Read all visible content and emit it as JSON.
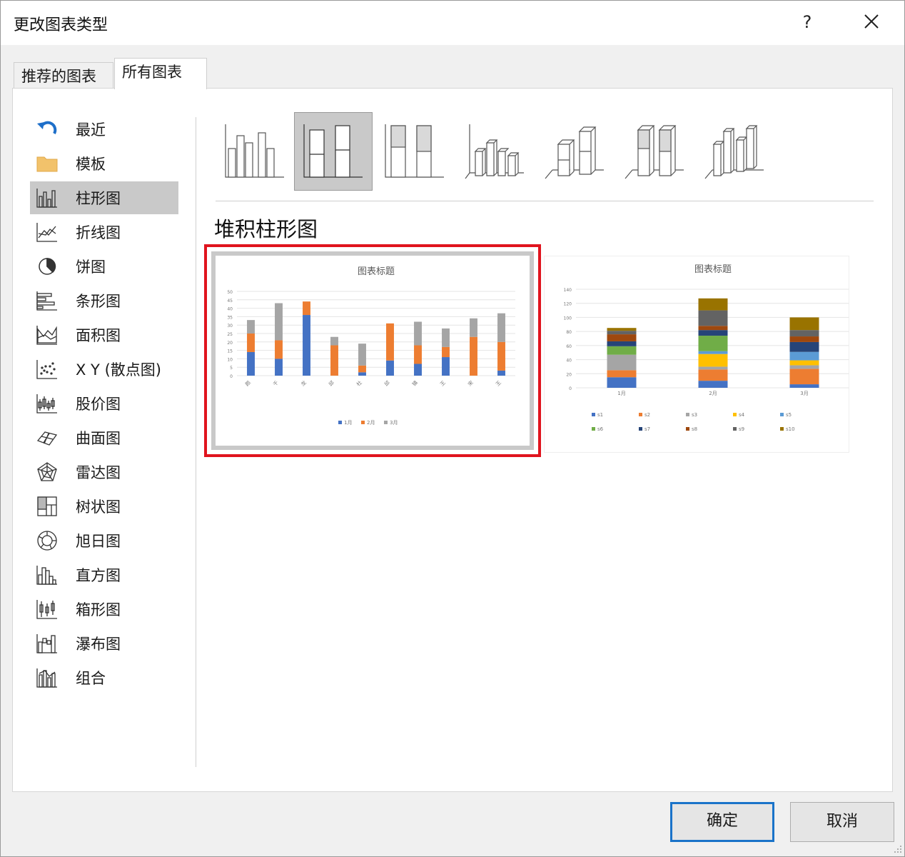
{
  "window": {
    "title": "更改图表类型",
    "help_label": "?"
  },
  "tabs": [
    {
      "label": "推荐的图表"
    },
    {
      "label": "所有图表"
    }
  ],
  "categories": [
    {
      "label": "最近",
      "icon": "recent-icon"
    },
    {
      "label": "模板",
      "icon": "folder-icon"
    },
    {
      "label": "柱形图",
      "icon": "column-chart-icon"
    },
    {
      "label": "折线图",
      "icon": "line-chart-icon"
    },
    {
      "label": "饼图",
      "icon": "pie-chart-icon"
    },
    {
      "label": "条形图",
      "icon": "bar-chart-icon"
    },
    {
      "label": "面积图",
      "icon": "area-chart-icon"
    },
    {
      "label": "X Y (散点图)",
      "icon": "scatter-chart-icon"
    },
    {
      "label": "股价图",
      "icon": "stock-chart-icon"
    },
    {
      "label": "曲面图",
      "icon": "surface-chart-icon"
    },
    {
      "label": "雷达图",
      "icon": "radar-chart-icon"
    },
    {
      "label": "树状图",
      "icon": "treemap-chart-icon"
    },
    {
      "label": "旭日图",
      "icon": "sunburst-chart-icon"
    },
    {
      "label": "直方图",
      "icon": "histogram-chart-icon"
    },
    {
      "label": "箱形图",
      "icon": "box-whisker-chart-icon"
    },
    {
      "label": "瀑布图",
      "icon": "waterfall-chart-icon"
    },
    {
      "label": "组合",
      "icon": "combo-chart-icon"
    }
  ],
  "selected_category": "柱形图",
  "subtypes": [
    "clustered-column-icon",
    "stacked-column-icon",
    "100-stacked-column-icon",
    "3d-clustered-column-icon",
    "3d-stacked-column-icon",
    "3d-100-stacked-column-icon",
    "3d-column-icon"
  ],
  "selected_subtype_name": "堆积柱形图",
  "chart_data": [
    {
      "type": "bar",
      "stacked": true,
      "title": "图表标题",
      "categories": [
        "颜",
        "千",
        "龙",
        "邱",
        "杜",
        "邱",
        "镇",
        "王",
        "宋",
        "王"
      ],
      "series": [
        {
          "name": "1月",
          "color": "#4472c4",
          "values": [
            14,
            10,
            36,
            0,
            2,
            9,
            7,
            11,
            0,
            3
          ]
        },
        {
          "name": "2月",
          "color": "#ed7d31",
          "values": [
            11,
            11,
            8,
            18,
            4,
            22,
            11,
            6,
            23,
            17
          ]
        },
        {
          "name": "3月",
          "color": "#a5a5a5",
          "values": [
            8,
            22,
            0,
            5,
            13,
            0,
            14,
            11,
            11,
            17
          ]
        }
      ],
      "ylim": [
        0,
        50
      ],
      "legend": "bottom"
    },
    {
      "type": "bar",
      "stacked": true,
      "title": "图表标题",
      "categories": [
        "1月",
        "2月",
        "3月"
      ],
      "series": [
        {
          "name": "s1",
          "color": "#4472c4",
          "values": [
            15,
            10,
            5
          ]
        },
        {
          "name": "s2",
          "color": "#ed7d31",
          "values": [
            10,
            16,
            22
          ]
        },
        {
          "name": "s3",
          "color": "#a5a5a5",
          "values": [
            22,
            4,
            5
          ]
        },
        {
          "name": "s4",
          "color": "#ffc000",
          "values": [
            0,
            18,
            7
          ]
        },
        {
          "name": "s5",
          "color": "#5b9bd5",
          "values": [
            0,
            4,
            12
          ]
        },
        {
          "name": "s6",
          "color": "#70ad47",
          "values": [
            12,
            22,
            0
          ]
        },
        {
          "name": "s7",
          "color": "#264478",
          "values": [
            7,
            8,
            14
          ]
        },
        {
          "name": "s8",
          "color": "#9e480e",
          "values": [
            10,
            6,
            8
          ]
        },
        {
          "name": "s9",
          "color": "#636363",
          "values": [
            5,
            22,
            9
          ]
        },
        {
          "name": "s10",
          "color": "#997300",
          "values": [
            4,
            17,
            18
          ]
        }
      ],
      "ylim": [
        0,
        140
      ],
      "legend": "bottom"
    }
  ],
  "buttons": {
    "ok": "确定",
    "cancel": "取消"
  }
}
